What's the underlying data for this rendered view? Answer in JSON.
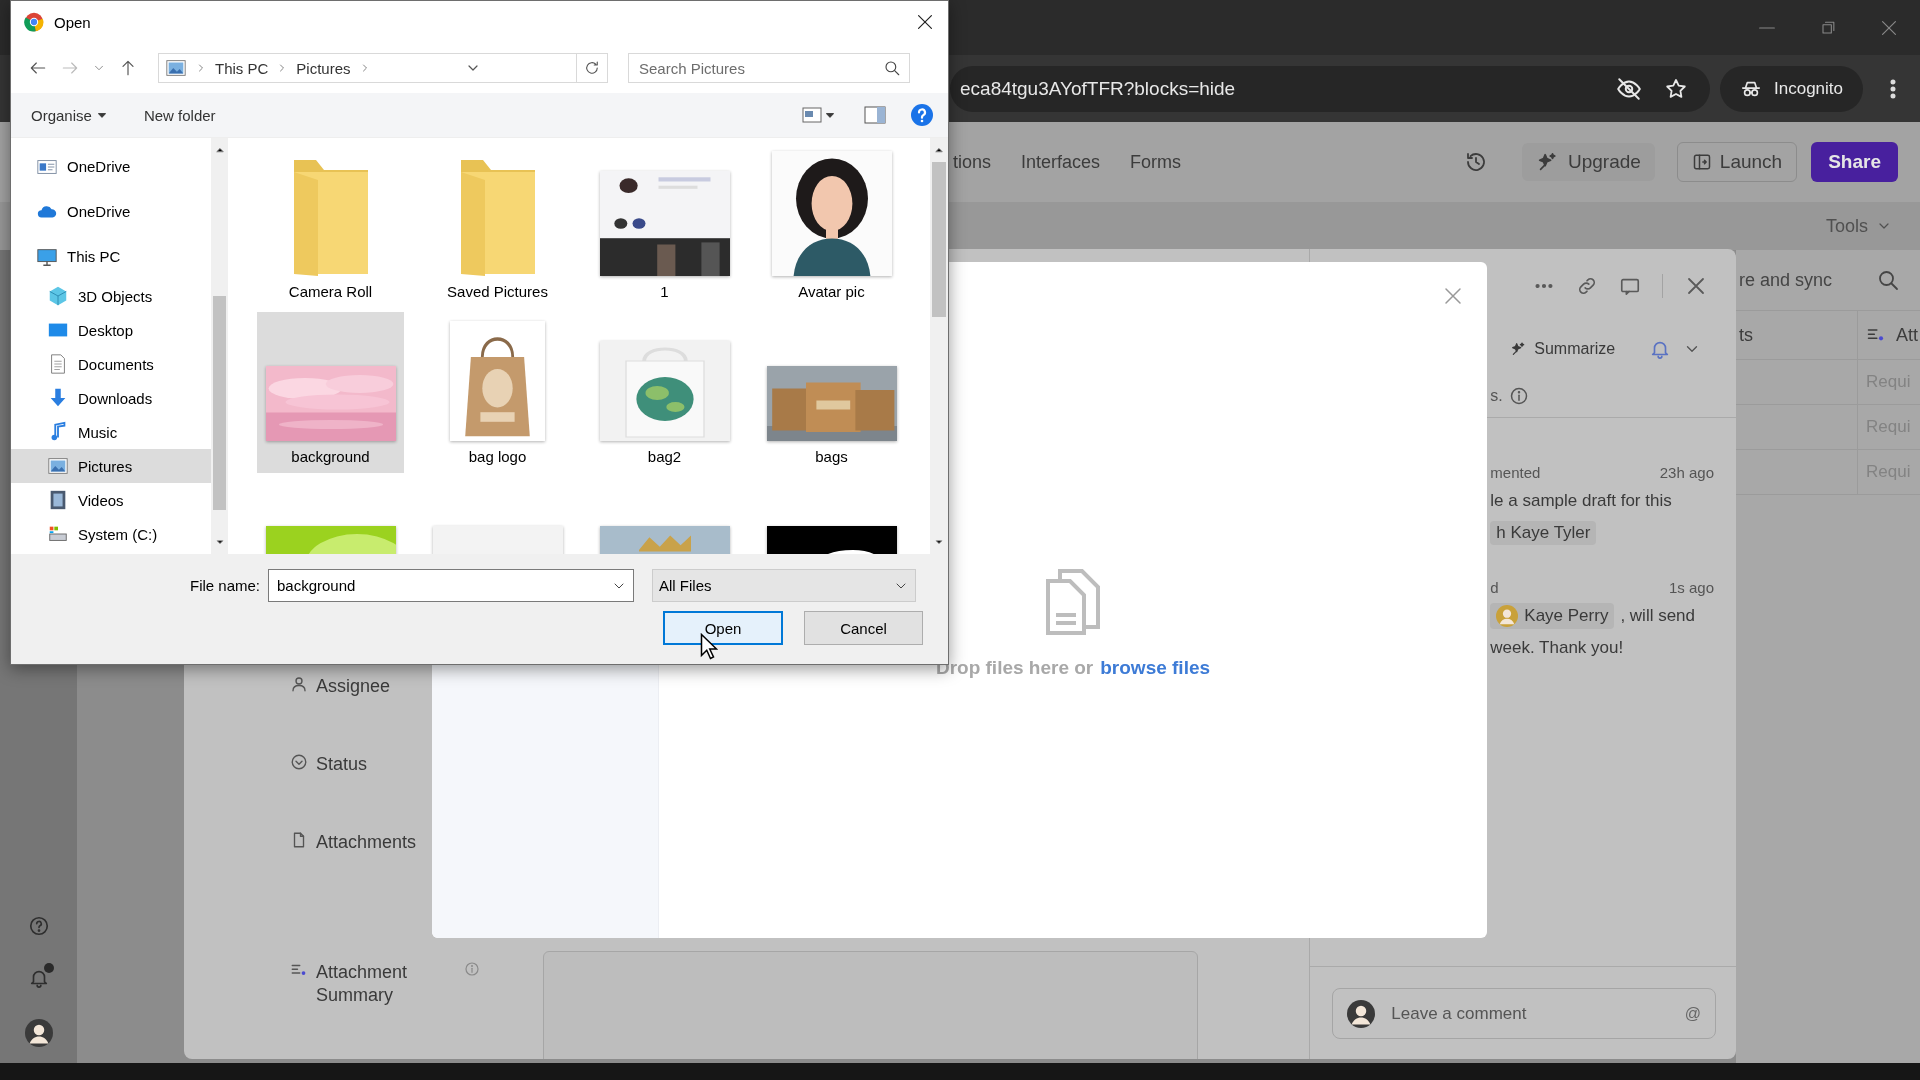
{
  "browser": {
    "url": "eca84tgu3AYofTFR?blocks=hide",
    "profile": "Incognito"
  },
  "app": {
    "nav": [
      "tions",
      "Interfaces",
      "Forms"
    ],
    "upgrade": "Upgrade",
    "launch": "Launch",
    "share": "Share",
    "tools": "Tools",
    "view_name": "re and sync",
    "grid": {
      "columns": [
        "ts",
        "Att"
      ],
      "cells": [
        "Requi",
        "Requi",
        "Requi"
      ]
    }
  },
  "record": {
    "fields": [
      {
        "kind": "person",
        "label": "Assignee",
        "info": false
      },
      {
        "kind": "status",
        "label": "Status",
        "info": false
      },
      {
        "kind": "file",
        "label": "Attachments",
        "info": false
      },
      {
        "kind": "summary",
        "label": "Attachment Summary",
        "info": true
      }
    ],
    "summarize": "Summarize",
    "note": "s.",
    "comments": [
      {
        "author": "mented",
        "time": "23h ago",
        "parts": [
          {
            "kind": "text",
            "text": "le a sample draft for this"
          },
          {
            "kind": "break"
          },
          {
            "kind": "mention",
            "text": "h Kaye Tyler",
            "avatar": false
          }
        ]
      },
      {
        "author": "d",
        "time": "1s ago",
        "parts": [
          {
            "kind": "mention",
            "text": "Kaye Perry",
            "avatar": true
          },
          {
            "kind": "text",
            "text": ", will send"
          },
          {
            "kind": "break"
          },
          {
            "kind": "text",
            "text": "week. Thank you!"
          }
        ]
      }
    ],
    "comment_placeholder": "Leave a comment",
    "mention_symbol": "@"
  },
  "upload": {
    "drop_text": "Drop files here or",
    "link": "browse files"
  },
  "dialog": {
    "title": "Open",
    "path": [
      "This PC",
      "Pictures"
    ],
    "search_placeholder": "Search Pictures",
    "organise": "Organise",
    "new_folder": "New folder",
    "nav": [
      {
        "kind": "onedrive",
        "label": "OneDrive",
        "selected": false
      },
      {
        "kind": "cloud",
        "label": "OneDrive",
        "selected": false
      },
      {
        "kind": "computer",
        "label": "This PC",
        "selected": false,
        "children": [
          {
            "kind": "cube",
            "label": "3D Objects",
            "selected": false
          },
          {
            "kind": "desktop",
            "label": "Desktop",
            "selected": false
          },
          {
            "kind": "document",
            "label": "Documents",
            "selected": false
          },
          {
            "kind": "download",
            "label": "Downloads",
            "selected": false
          },
          {
            "kind": "music",
            "label": "Music",
            "selected": false
          },
          {
            "kind": "pictures",
            "label": "Pictures",
            "selected": true
          },
          {
            "kind": "video",
            "label": "Videos",
            "selected": false
          },
          {
            "kind": "drive",
            "label": "System (C:)",
            "selected": false
          }
        ]
      }
    ],
    "files": [
      {
        "kind": "folder",
        "name": "Camera Roll",
        "selected": false
      },
      {
        "kind": "folder",
        "name": "Saved Pictures",
        "selected": false
      },
      {
        "kind": "picture",
        "name": "1",
        "selected": false
      },
      {
        "kind": "picture",
        "name": "Avatar pic",
        "selected": false
      },
      {
        "kind": "picture",
        "name": "background",
        "selected": true
      },
      {
        "kind": "picture",
        "name": "bag logo",
        "selected": false
      },
      {
        "kind": "picture",
        "name": "bag2",
        "selected": false
      },
      {
        "kind": "picture",
        "name": "bags",
        "selected": false
      },
      {
        "kind": "picture",
        "selected": false
      },
      {
        "kind": "picture",
        "selected": false
      },
      {
        "kind": "picture",
        "selected": false
      },
      {
        "kind": "picture",
        "selected": false
      }
    ],
    "file_name_label": "File name:",
    "file_name": "background",
    "filter": "All Files",
    "open": "Open",
    "cancel": "Cancel"
  }
}
